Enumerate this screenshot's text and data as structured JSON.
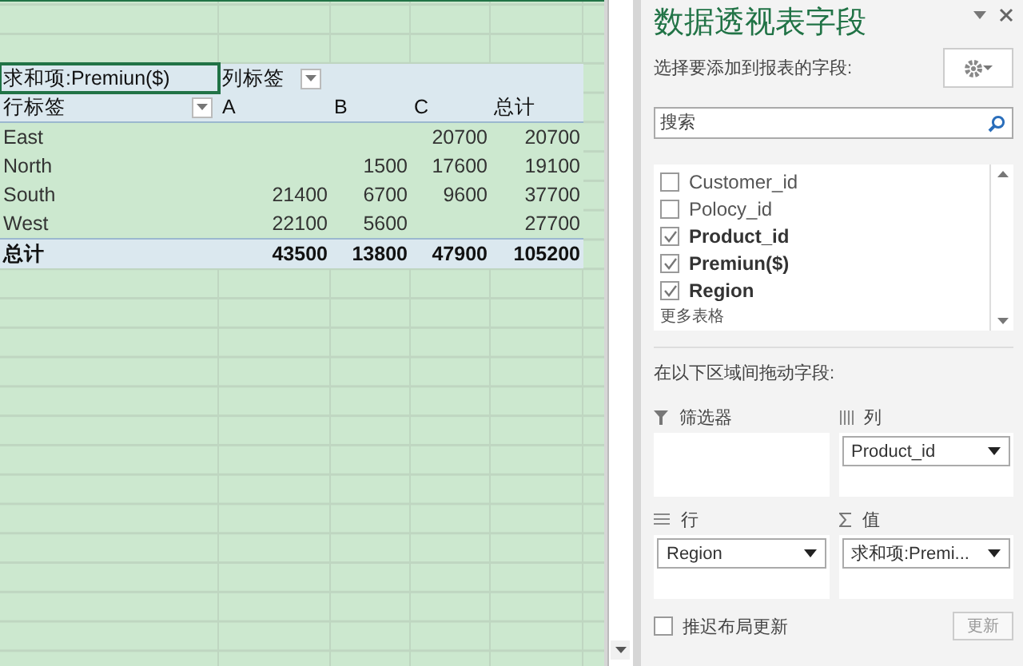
{
  "sheet": {
    "pivot": {
      "value_label": "求和项:Premiun($)",
      "column_label": "列标签",
      "row_label": "行标签",
      "columns": [
        "A",
        "B",
        "C",
        "总计"
      ],
      "rows": [
        {
          "label": "East",
          "c": "20700",
          "total": "20700"
        },
        {
          "label": "North",
          "b": "1500",
          "c": "17600",
          "total": "19100"
        },
        {
          "label": "South",
          "a": "21400",
          "b": "6700",
          "c": "9600",
          "total": "37700"
        },
        {
          "label": "West",
          "a": "22100",
          "b": "5600",
          "total": "27700"
        }
      ],
      "total": {
        "label": "总计",
        "a": "43500",
        "b": "13800",
        "c": "47900",
        "total": "105200"
      }
    }
  },
  "panel": {
    "title": "数据透视表字段",
    "prompt": "选择要添加到报表的字段:",
    "search": {
      "placeholder": "搜索"
    },
    "fields": [
      {
        "label": "Customer_id",
        "checked": false
      },
      {
        "label": "Polocy_id",
        "checked": false
      },
      {
        "label": "Product_id",
        "checked": true
      },
      {
        "label": "Premiun($)",
        "checked": true
      },
      {
        "label": "Region",
        "checked": true
      }
    ],
    "more_tables": "更多表格",
    "areas_prompt": "在以下区域间拖动字段:",
    "areas": [
      {
        "kind": "filter",
        "label": "筛选器"
      },
      {
        "kind": "columns",
        "label": "列",
        "items": [
          "Product_id"
        ]
      },
      {
        "kind": "rows",
        "label": "行",
        "items": [
          "Region"
        ]
      },
      {
        "kind": "values",
        "label": "值",
        "items": [
          "求和项:Premi..."
        ]
      }
    ],
    "defer": {
      "label": "推迟布局更新",
      "checked": false
    },
    "update_button": "更新"
  }
}
